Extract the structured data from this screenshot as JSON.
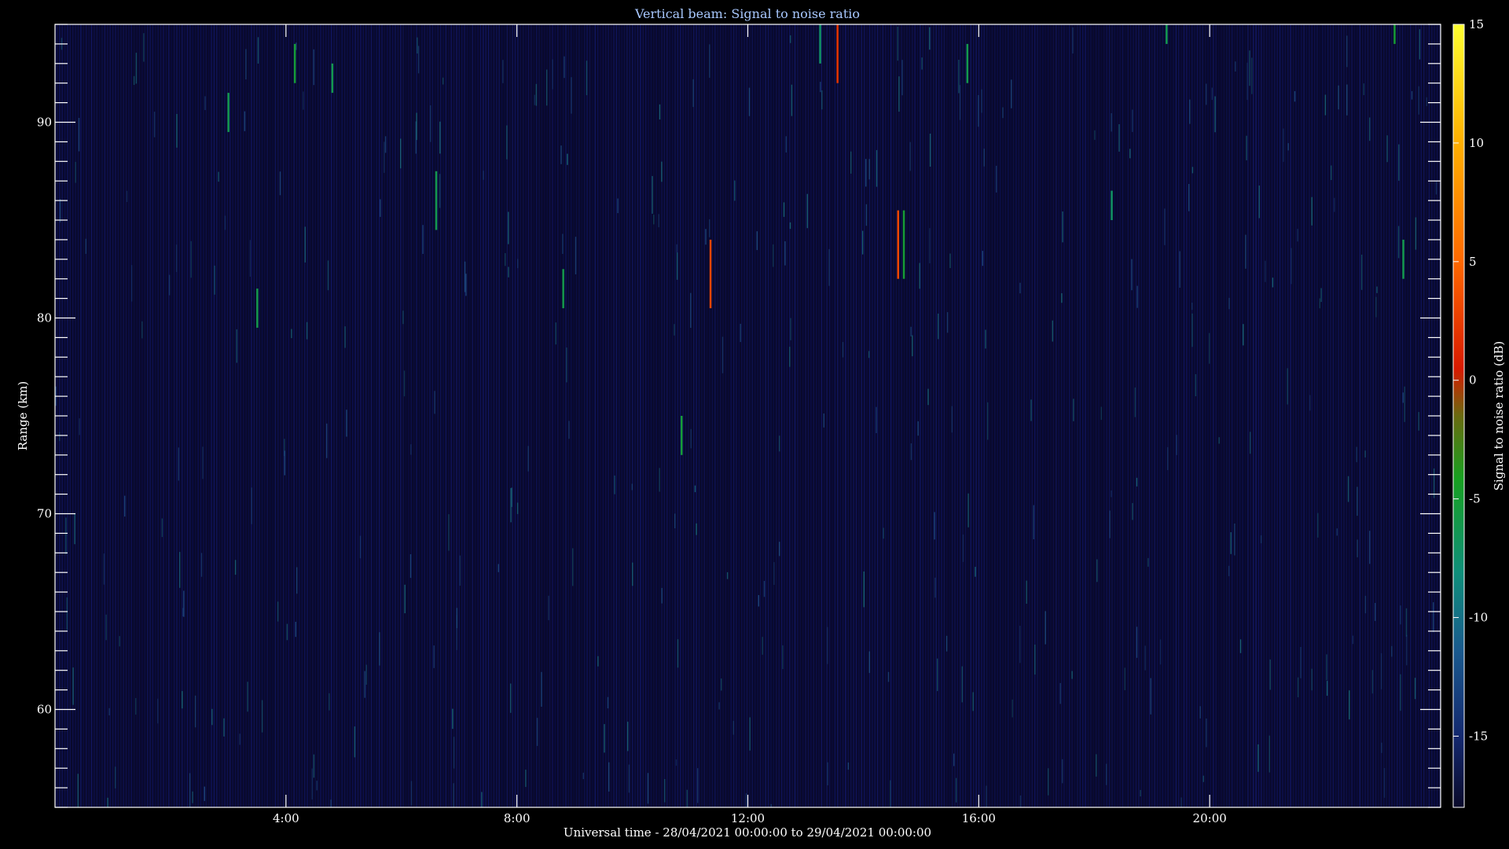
{
  "chart_data": {
    "type": "heatmap",
    "title": "Vertical beam: Signal to noise ratio",
    "xlabel": "Universal time - 28/04/2021 00:00:00 to 29/04/2021 00:00:00",
    "ylabel": "Range (km)",
    "colorbar_label": "Signal to noise ratio (dB)",
    "xlim_hours": [
      0,
      24
    ],
    "ylim_km": [
      55,
      95
    ],
    "zlim_db": [
      -18,
      15
    ],
    "x_ticks": [
      {
        "value": 4,
        "label": "4:00"
      },
      {
        "value": 8,
        "label": "8:00"
      },
      {
        "value": 12,
        "label": "12:00"
      },
      {
        "value": 16,
        "label": "16:00"
      },
      {
        "value": 20,
        "label": "20:00"
      }
    ],
    "y_ticks": [
      {
        "value": 60,
        "label": "60"
      },
      {
        "value": 70,
        "label": "70"
      },
      {
        "value": 80,
        "label": "80"
      },
      {
        "value": 90,
        "label": "90"
      }
    ],
    "colorbar_ticks": [
      {
        "value": 15,
        "label": "15"
      },
      {
        "value": 10,
        "label": "10"
      },
      {
        "value": 5,
        "label": "5"
      },
      {
        "value": 0,
        "label": "0"
      },
      {
        "value": -5,
        "label": "-5"
      },
      {
        "value": -10,
        "label": "-10"
      },
      {
        "value": -15,
        "label": "-15"
      }
    ],
    "background_level_db": -17,
    "echoes": [
      {
        "hour": 4.15,
        "range_from": 92,
        "range_to": 94,
        "snr": -5
      },
      {
        "hour": 4.8,
        "range_from": 91.5,
        "range_to": 93,
        "snr": -6
      },
      {
        "hour": 3.0,
        "range_from": 89.5,
        "range_to": 91.5,
        "snr": -6
      },
      {
        "hour": 3.5,
        "range_from": 79.5,
        "range_to": 81.5,
        "snr": -6
      },
      {
        "hour": 6.6,
        "range_from": 84.5,
        "range_to": 87.5,
        "snr": -6
      },
      {
        "hour": 8.8,
        "range_from": 80.5,
        "range_to": 82.5,
        "snr": -6
      },
      {
        "hour": 10.85,
        "range_from": 73,
        "range_to": 75,
        "snr": -5
      },
      {
        "hour": 11.35,
        "range_from": 80.5,
        "range_to": 84,
        "snr": 3
      },
      {
        "hour": 13.55,
        "range_from": 92,
        "range_to": 95,
        "snr": 2
      },
      {
        "hour": 13.25,
        "range_from": 93,
        "range_to": 95,
        "snr": -7
      },
      {
        "hour": 14.6,
        "range_from": 82,
        "range_to": 85.5,
        "snr": 3
      },
      {
        "hour": 14.7,
        "range_from": 82,
        "range_to": 85.5,
        "snr": -5
      },
      {
        "hour": 15.8,
        "range_from": 92,
        "range_to": 94,
        "snr": -6
      },
      {
        "hour": 18.3,
        "range_from": 85,
        "range_to": 86.5,
        "snr": -7
      },
      {
        "hour": 19.25,
        "range_from": 94,
        "range_to": 95,
        "snr": -6
      },
      {
        "hour": 23.35,
        "range_from": 82,
        "range_to": 84,
        "snr": -6
      },
      {
        "hour": 23.2,
        "range_from": 94,
        "range_to": 95,
        "snr": -5
      }
    ]
  }
}
